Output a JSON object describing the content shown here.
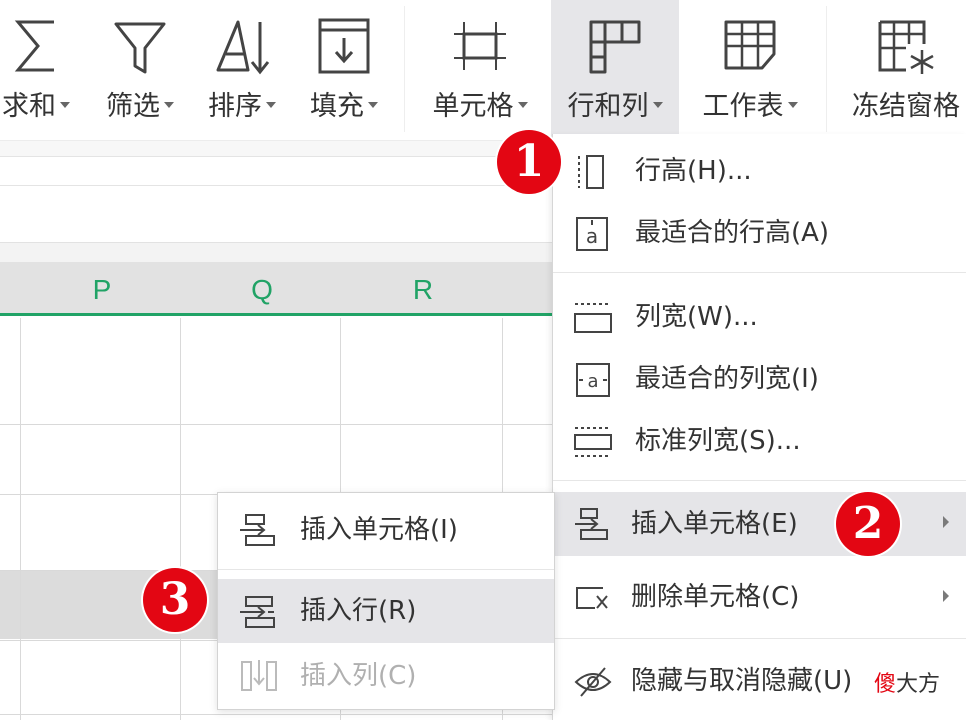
{
  "ribbon": {
    "buttons": [
      {
        "id": "sum",
        "label": "求和",
        "icon": "sigma-icon"
      },
      {
        "id": "filter",
        "label": "筛选",
        "icon": "funnel-icon"
      },
      {
        "id": "sort",
        "label": "排序",
        "icon": "sort-icon"
      },
      {
        "id": "fill",
        "label": "填充",
        "icon": "fill-down-icon"
      },
      {
        "id": "cell",
        "label": "单元格",
        "icon": "cell-icon"
      },
      {
        "id": "rowcol",
        "label": "行和列",
        "icon": "row-column-icon",
        "active": true
      },
      {
        "id": "sheet",
        "label": "工作表",
        "icon": "worksheet-icon"
      },
      {
        "id": "freeze",
        "label": "冻结窗格",
        "icon": "freeze-panes-icon"
      }
    ]
  },
  "columns": [
    "P",
    "Q",
    "R"
  ],
  "menu": {
    "items": [
      {
        "label": "行高(H)...",
        "icon": "row-height-icon"
      },
      {
        "label": "最适合的行高(A)",
        "icon": "autofit-row-height-icon"
      },
      {
        "label": "列宽(W)...",
        "icon": "column-width-icon"
      },
      {
        "label": "最适合的列宽(I)",
        "icon": "autofit-column-width-icon"
      },
      {
        "label": "标准列宽(S)...",
        "icon": "standard-column-width-icon"
      },
      {
        "label": "插入单元格(E)",
        "icon": "insert-cells-icon",
        "submenu": true,
        "highlighted": true
      },
      {
        "label": "删除单元格(C)",
        "icon": "delete-cells-icon",
        "submenu": true
      },
      {
        "label": "隐藏与取消隐藏(U)",
        "icon": "hide-eye-icon"
      }
    ]
  },
  "submenu": {
    "items": [
      {
        "label": "插入单元格(I)",
        "icon": "insert-cells-icon",
        "enabled": true
      },
      {
        "label": "插入行(R)",
        "icon": "insert-row-icon",
        "enabled": true,
        "highlighted": true
      },
      {
        "label": "插入列(C)",
        "icon": "insert-column-icon",
        "enabled": false
      }
    ]
  },
  "steps": [
    "1",
    "2",
    "3"
  ],
  "watermark": {
    "part1": "傻",
    "part2": "大方"
  },
  "colors": {
    "accent_green": "#21a366",
    "badge_red": "#e30613",
    "highlight": "#e5e5e8"
  }
}
